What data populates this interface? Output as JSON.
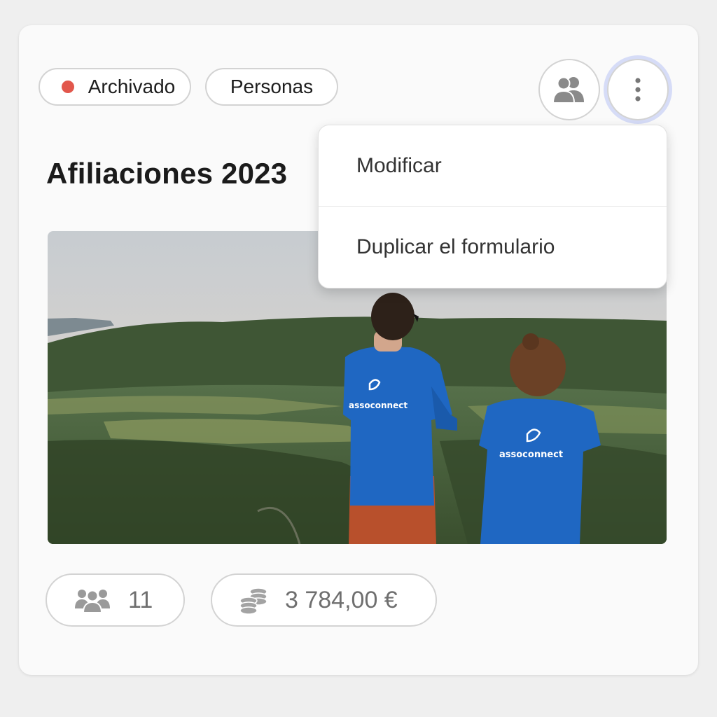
{
  "card": {
    "status_chip": {
      "label": "Archivado",
      "dot_color": "#e2574c",
      "icon": "status-dot-red"
    },
    "type_chip": {
      "label": "Personas"
    },
    "title": "Afiliaciones 2023",
    "actions": {
      "group_icon": "people-icon",
      "more_icon": "vertical-dots-icon"
    },
    "dropdown": {
      "items": [
        {
          "label": "Modificar"
        },
        {
          "label": "Duplicar el formulario"
        }
      ]
    },
    "image": {
      "shirt_text_left": "assoconnect",
      "shirt_text_right": "assoconnect"
    },
    "stats": {
      "members": {
        "icon": "people-icon",
        "value": "11"
      },
      "amount": {
        "icon": "coins-icon",
        "value": "3 784,00 €"
      }
    }
  },
  "colors": {
    "accent_focus": "#d6dcf7",
    "status_archived": "#e2574c",
    "shirt_blue": "#1f67c2"
  }
}
